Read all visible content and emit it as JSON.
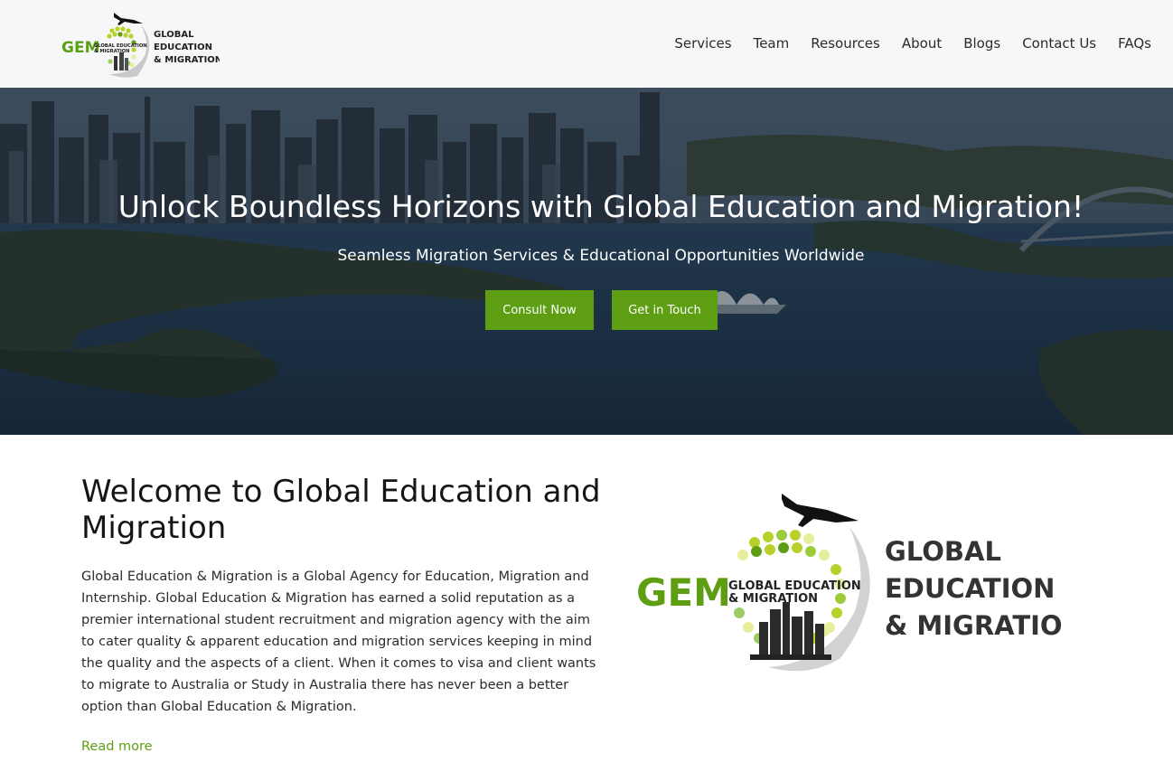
{
  "header": {
    "logo_word": "GEM",
    "logo_lines": [
      "GLOBAL",
      "EDUCATION",
      "& MIGRATION"
    ],
    "logo_inner": [
      "GLOBAL EDUCATION",
      "& MIGRATION"
    ],
    "nav": [
      "Services",
      "Team",
      "Resources",
      "About",
      "Blogs",
      "Contact Us",
      "FAQs"
    ]
  },
  "hero": {
    "title": "Unlock Boundless Horizons with Global Education and Migration!",
    "subtitle": "Seamless Migration Services & Educational Opportunities Worldwide",
    "consult_label": "Consult Now",
    "touch_label": "Get in Touch"
  },
  "welcome": {
    "title": "Welcome to Global Education and Migration",
    "body": "Global Education & Migration is a Global Agency for Education, Migration and Internship. Global Education & Migration has earned a solid reputation as a premier international student recruitment and migration agency with the aim to cater quality & apparent education and migration services keeping in mind the quality and the aspects of a client. When it comes to visa and client wants to migrate to Australia or Study in Australia there has never been a better option than Global Education & Migration.",
    "read_more": "Read more"
  },
  "colors": {
    "accent": "#5d9e12",
    "header_bg": "#f5f7f9",
    "hero_overlay": "#1b2a3a"
  }
}
